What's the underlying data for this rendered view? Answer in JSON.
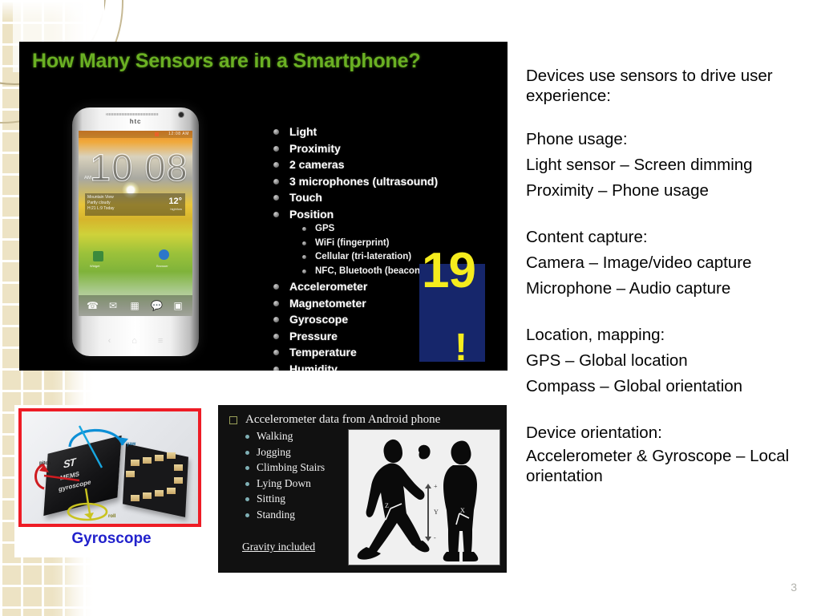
{
  "slide": {
    "page_number": "3"
  },
  "sensor_panel": {
    "title": "How Many Sensors are in a Smartphone?",
    "sensors": [
      {
        "label": "Light",
        "level": 1
      },
      {
        "label": "Proximity",
        "level": 1
      },
      {
        "label": "2 cameras",
        "level": 1
      },
      {
        "label": "3 microphones (ultrasound)",
        "level": 1
      },
      {
        "label": "Touch",
        "level": 1
      },
      {
        "label": "Position",
        "level": 1
      },
      {
        "label": "GPS",
        "level": 2
      },
      {
        "label": "WiFi (fingerprint)",
        "level": 2
      },
      {
        "label": "Cellular (tri-lateration)",
        "level": 2
      },
      {
        "label": "NFC, Bluetooth (beacons)",
        "level": 2
      },
      {
        "label": "Accelerometer",
        "level": 1
      },
      {
        "label": "Magnetometer",
        "level": 1
      },
      {
        "label": "Gyroscope",
        "level": 1
      },
      {
        "label": "Pressure",
        "level": 1
      },
      {
        "label": "Temperature",
        "level": 1
      },
      {
        "label": "Humidity",
        "level": 1
      }
    ],
    "count_badge": {
      "number": "19",
      "exclamation": "!",
      "background_color": "#16266b",
      "text_color": "#f5ec1d"
    },
    "title_color": "#6ab023",
    "background_color": "#000000",
    "phone": {
      "brand": "htc",
      "clock": "10 08",
      "am_pm": "AM",
      "status_text": "12:08 AM",
      "weather_city": "Mountain View\nPartly cloudy\nH:21 L:9 Today",
      "temperature": "12°",
      "temperature_unit": "high/low",
      "app_labels": [
        "Widget",
        "Browser"
      ],
      "dock_icons": [
        "phone-icon",
        "messages-icon",
        "apps-grid-icon",
        "chat-icon",
        "camera-icon"
      ],
      "nav_icons": [
        "back-icon",
        "home-icon",
        "recents-icon"
      ]
    }
  },
  "gyro_panel": {
    "caption": "Gyroscope",
    "caption_color": "#2222cc",
    "border_color": "#ee1c25",
    "chip_logo": "ST",
    "chip_text_line1": "MEMS",
    "chip_text_line2": "gyroscope",
    "axis_labels": [
      "pitch",
      "yaw",
      "roll"
    ]
  },
  "accel_panel": {
    "heading": "Accelerometer data from Android phone",
    "activities": [
      "Walking",
      "Jogging",
      "Climbing Stairs",
      "Lying Down",
      "Sitting",
      "Standing"
    ],
    "footnote": "Gravity included",
    "figure_axis_labels": [
      "+",
      "Y",
      "-",
      "Z",
      "X"
    ],
    "background_color": "#111111"
  },
  "right_text": {
    "intro": "Devices use sensors to drive user experience:",
    "sections": [
      {
        "heading": "Phone usage:",
        "lines": [
          "Light sensor – Screen dimming",
          "Proximity – Phone usage"
        ]
      },
      {
        "heading": "Content capture:",
        "lines": [
          "Camera – Image/video capture",
          "Microphone – Audio capture"
        ]
      },
      {
        "heading": "Location, mapping:",
        "lines": [
          "GPS – Global location",
          "Compass – Global orientation"
        ]
      },
      {
        "heading": "Device orientation:",
        "lines": [
          "Accelerometer & Gyroscope – Local orientation"
        ]
      }
    ]
  }
}
